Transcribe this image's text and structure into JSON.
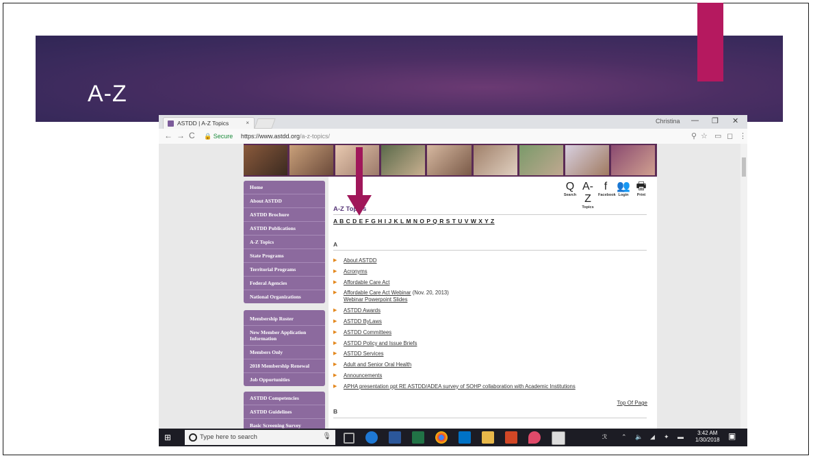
{
  "slide": {
    "title": "A-Z"
  },
  "browser": {
    "tab_title": "ASTDD | A-Z Topics",
    "tab_close": "×",
    "user_name": "Christina",
    "minimize": "—",
    "restore": "❐",
    "close": "✕",
    "secure_label": "Secure",
    "url_host": "https://www.astdd.org",
    "url_path": "/a-z-topics/"
  },
  "site": {
    "menu_groups": [
      [
        "Home",
        "About ASTDD",
        "ASTDD Brochure",
        "ASTDD Publications",
        "A-Z Topics",
        "State Programs",
        "Territorial Programs",
        "Federal Agencies",
        "National Organizations"
      ],
      [
        "Membership Roster",
        "New Member Application Information",
        "Members Only",
        "2018 Membership Renewal",
        "Job Opportunities"
      ],
      [
        "ASTDD Competencies",
        "ASTDD Guidelines",
        "Basic Screening Survey"
      ]
    ],
    "header_icons": [
      {
        "glyph": "Q",
        "label": "Search",
        "icon": "search-icon"
      },
      {
        "glyph": "A-Z",
        "label": "Topics",
        "icon": "az-topics-icon"
      },
      {
        "glyph": "f",
        "label": "Facebook",
        "icon": "facebook-icon"
      },
      {
        "glyph": "👥",
        "label": "Login",
        "icon": "login-icon"
      },
      {
        "glyph": "🖶",
        "label": "Print",
        "icon": "print-icon"
      }
    ],
    "heading": "A-Z Topics",
    "letters": "A B C D E F G H I J K L M N O P Q R S T U V W X Y Z",
    "section_a": "A",
    "links": [
      {
        "text": "About ASTDD",
        "suffix": ""
      },
      {
        "text": "Acronyms",
        "suffix": ""
      },
      {
        "text": "Affordable Care Act",
        "suffix": ""
      },
      {
        "text": "Affordable Care Act Webinar",
        "suffix": " (Nov. 20, 2013)",
        "sub": "Webinar Powerpoint Slides"
      },
      {
        "text": "ASTDD Awards",
        "suffix": ""
      },
      {
        "text": "ASTDD ByLaws",
        "suffix": ""
      },
      {
        "text": "ASTDD Committees",
        "suffix": ""
      },
      {
        "text": "ASTDD Policy and Issue Briefs",
        "suffix": ""
      },
      {
        "text": "ASTDD Services",
        "suffix": ""
      },
      {
        "text": "Adult and Senior Oral Health",
        "suffix": ""
      },
      {
        "text": "Announcements",
        "suffix": ""
      },
      {
        "text": "APHA presentation ppt RE ASTDD/ADEA survey of SOHP collaboration with Academic Institutions",
        "suffix": ""
      }
    ],
    "top_of_page": "Top Of Page",
    "section_b": "B"
  },
  "taskbar": {
    "search_placeholder": "Type here to search",
    "time": "3:42 AM",
    "date": "1/30/2018",
    "notification_count": "3"
  },
  "colors": {
    "accent": "#b5195f",
    "banner": "#4b2e63",
    "menu": "#8c6a9e",
    "arrow": "#a0175a"
  }
}
